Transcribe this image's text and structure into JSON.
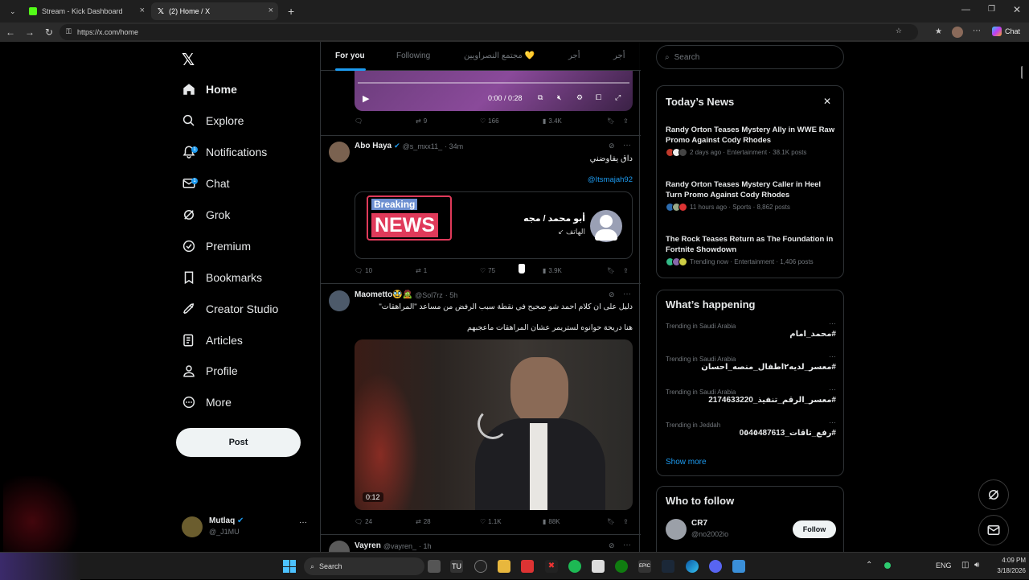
{
  "browser": {
    "tabs": [
      {
        "label": "Stream - Kick Dashboard",
        "active": false
      },
      {
        "label": "(2) Home / X",
        "active": true
      }
    ],
    "url": "https://x.com/home",
    "copilot_label": "Chat"
  },
  "sidebar": {
    "items": [
      {
        "label": "Home",
        "icon": "home-icon",
        "badge": ""
      },
      {
        "label": "Explore",
        "icon": "search-icon",
        "badge": ""
      },
      {
        "label": "Notifications",
        "icon": "bell-icon",
        "badge": "1"
      },
      {
        "label": "Chat",
        "icon": "mail-icon",
        "badge": "1"
      },
      {
        "label": "Grok",
        "icon": "grok-icon",
        "badge": ""
      },
      {
        "label": "Premium",
        "icon": "verified-icon",
        "badge": ""
      },
      {
        "label": "Bookmarks",
        "icon": "bookmark-icon",
        "badge": ""
      },
      {
        "label": "Creator Studio",
        "icon": "rocket-icon",
        "badge": ""
      },
      {
        "label": "Articles",
        "icon": "article-icon",
        "badge": ""
      },
      {
        "label": "Profile",
        "icon": "person-icon",
        "badge": ""
      },
      {
        "label": "More",
        "icon": "more-icon",
        "badge": ""
      }
    ],
    "post_button": "Post",
    "account": {
      "name": "Mutlaq",
      "handle": "@_J1MU"
    }
  },
  "timeline": {
    "tabs": [
      "For you",
      "Following",
      "مجتمع النصراويين 💛",
      "أجر",
      "أجر"
    ],
    "video1": {
      "time": "0:00 / 0:28"
    },
    "actions1": {
      "replies": "",
      "reposts": "9",
      "likes": "166",
      "views": "3.4K"
    },
    "tweet2": {
      "name": "Abo Haya",
      "handle": "@s_mxx11_",
      "time": "· 34m",
      "text": "داق يفاوضني",
      "mention": "@Itsmajah92",
      "card_breaking": "Breaking",
      "card_news": "NEWS",
      "card_title": "أبو محمد / مجه",
      "card_sub": "الهاتف ↙",
      "replies": "10",
      "reposts": "1",
      "likes": "75",
      "views": "3.9K"
    },
    "tweet3": {
      "name": "Maometto🥸🧟",
      "handle": "@Sol7rz",
      "time": "· 5h",
      "text1": "دليل على ان كلام احمد شو صحيح في نقطة سبب الرفض من مساعد \"المراهقات\"",
      "text2": "هنا دريحة حوانوه لستريمر عشان المراهقات ماعجبهم",
      "video_time": "0:12",
      "replies": "24",
      "reposts": "28",
      "likes": "1.1K",
      "views": "88K"
    },
    "tweet4": {
      "name": "Vayren",
      "handle": "@vayren_",
      "time": "· 1h"
    }
  },
  "right": {
    "search_placeholder": "Search",
    "news": {
      "title": "Today’s News",
      "items": [
        {
          "title": "Randy Orton Teases Mystery Ally in WWE Raw Promo Against Cody Rhodes",
          "meta": "2 days ago · Entertainment · 38.1K posts"
        },
        {
          "title": "Randy Orton Teases Mystery Caller in Heel Turn Promo Against Cody Rhodes",
          "meta": "11 hours ago · Sports · 8,862 posts"
        },
        {
          "title": "The Rock Teases Return as The Foundation in Fortnite Showdown",
          "meta": "Trending now · Entertainment · 1,406 posts"
        }
      ]
    },
    "happening": {
      "title": "What’s happening",
      "items": [
        {
          "location": "Trending in Saudi Arabia",
          "tag": "#محمد_امام"
        },
        {
          "location": "Trending in Saudi Arabia",
          "tag": "#معسر_لديه٢اطفال_منصه_احسان"
        },
        {
          "location": "Trending in Saudi Arabia",
          "tag": "#معسر_الرقم_تنفيذ_2174633220"
        },
        {
          "location": "Trending in Jeddah",
          "tag": "#رفع_تاقات_0٥4٥487613"
        }
      ],
      "show_more": "Show more"
    },
    "follow": {
      "title": "Who to follow",
      "items": [
        {
          "name": "CR7",
          "handle": "@no2002io",
          "button": "Follow"
        }
      ]
    }
  },
  "taskbar": {
    "search": "Search",
    "lang": "ENG",
    "time": "4:09 PM",
    "date": "3/18/2026"
  },
  "colors": {
    "accent": "#1d9bf0",
    "background": "#000000",
    "border": "#2f3336",
    "muted": "#71767b"
  }
}
